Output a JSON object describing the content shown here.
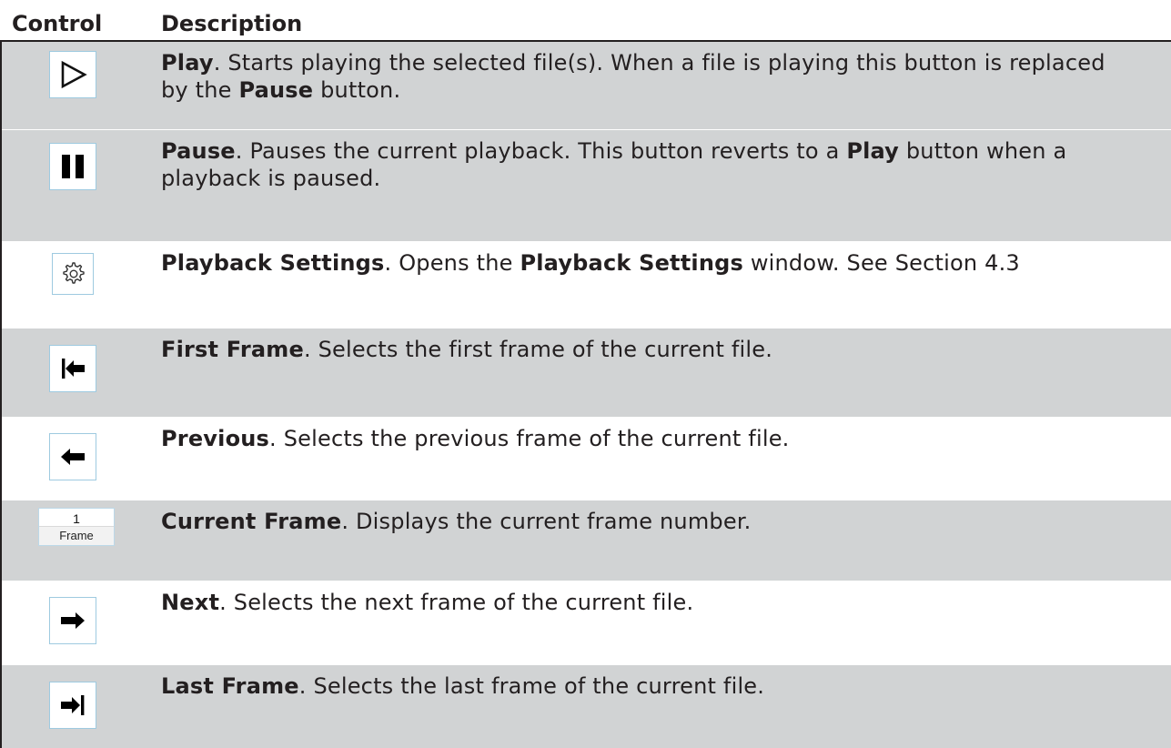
{
  "header": {
    "col_control": "Control",
    "col_description": "Description"
  },
  "rows": [
    {
      "icon": "play-outline-icon",
      "title": "Play",
      "text_1": ". Starts playing the selected file(s). When a file is playing this button is replaced by the ",
      "bold_2": "Pause",
      "text_2": " button."
    },
    {
      "icon": "pause-icon",
      "title": "Pause",
      "text_1": ". Pauses the current playback. This button reverts to a ",
      "bold_2": "Play",
      "text_2": " button when a playback is paused."
    },
    {
      "icon": "gear-icon",
      "title": "Playback Settings",
      "text_1": ". Opens the ",
      "bold_2": "Playback Settings",
      "text_2": " window. See Section 4.3"
    },
    {
      "icon": "first-frame-icon",
      "title": "First Frame",
      "text_1": ". Selects the first frame of the current file."
    },
    {
      "icon": "previous-arrow-icon",
      "title": "Previous",
      "text_1": ". Selects the previous frame of the current file."
    },
    {
      "icon": "frame-counter",
      "frame_value": "1",
      "frame_label": "Frame",
      "title": "Current Frame",
      "text_1": ". Displays the current frame number."
    },
    {
      "icon": "next-arrow-icon",
      "title": "Next",
      "text_1": ". Selects the next frame of the current file."
    },
    {
      "icon": "last-frame-icon",
      "title": "Last Frame",
      "text_1": ". Selects the last frame of the current file."
    }
  ],
  "colors": {
    "row_shade": "#d1d3d4",
    "text": "#231f20",
    "button_border": "#9ecae0"
  }
}
